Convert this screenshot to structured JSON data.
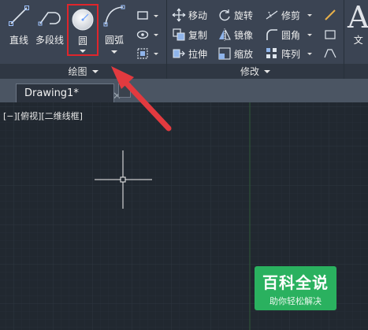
{
  "ribbon": {
    "draw_panel": {
      "title": "绘图",
      "tools": {
        "line": "直线",
        "polyline": "多段线",
        "circle": "圆",
        "arc": "圆弧"
      }
    },
    "modify_panel": {
      "title": "修改",
      "tools": {
        "move": "移动",
        "rotate": "旋转",
        "trim": "修剪",
        "copy": "复制",
        "mirror": "镜像",
        "fillet": "圆角",
        "stretch": "拉伸",
        "scale": "缩放",
        "array": "阵列"
      }
    },
    "annotation_panel": {
      "text_label_partial": "文"
    }
  },
  "tabs": [
    {
      "label": "Drawing1*",
      "active": true
    }
  ],
  "viewport": {
    "label": "[−][俯视][二维线框]"
  },
  "watermark": {
    "title": "百科全说",
    "subtitle": "助你轻松解决"
  },
  "colors": {
    "ribbon_bg": "#3b4453",
    "canvas_bg": "#212830",
    "highlight": "#e0252b",
    "arrow": "#e23a3f",
    "watermark_bg": "#2ab15f"
  },
  "icons": {
    "line": "line-icon",
    "polyline": "polyline-icon",
    "circle": "circle-icon",
    "arc": "arc-icon",
    "move": "move-icon",
    "rotate": "rotate-icon",
    "trim": "trim-icon",
    "copy": "copy-icon",
    "mirror": "mirror-icon",
    "fillet": "fillet-icon",
    "stretch": "stretch-icon",
    "scale": "scale-icon",
    "array": "array-icon"
  }
}
